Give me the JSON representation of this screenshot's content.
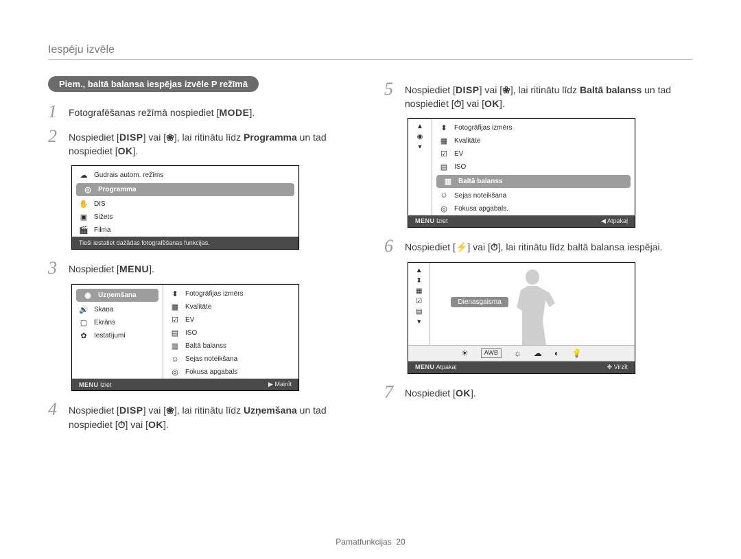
{
  "header": "Iespēju izvēle",
  "example_pill": "Piem., baltā balansa iespējas izvēle P režīmā",
  "keys": {
    "mode": "MODE",
    "disp": "DISP",
    "menu": "MENU",
    "ok": "OK"
  },
  "sym": {
    "flower": "❀",
    "timer": "⏱",
    "flash": "⚡",
    "left": "◀",
    "right": "▶",
    "scroll": "↕"
  },
  "steps": {
    "s1": "Fotografēšanas režīmā nospiediet [",
    "s1_end": "].",
    "s2_a": "Nospiediet [",
    "s2_b": "] vai [",
    "s2_c": "], lai ritinātu līdz ",
    "s2_programma": "Programma",
    "s2_d": " un tad nospiediet [",
    "s2_e": "].",
    "s3": "Nospiediet [",
    "s3_end": "].",
    "s4_a": "Nospiediet [",
    "s4_b": "] vai [",
    "s4_c": "], lai ritinātu līdz ",
    "s4_uznem": "Uzņemšana",
    "s4_d": " un tad nospiediet [",
    "s4_e": "] vai [",
    "s4_f": "].",
    "s5_a": "Nospiediet [",
    "s5_b": "] vai [",
    "s5_c": "], lai ritinātu līdz ",
    "s5_bb": "Baltā balanss",
    "s5_d": " un tad nospiediet [",
    "s5_e": "] vai [",
    "s5_f": "].",
    "s6_a": "Nospiediet [",
    "s6_b": "] vai [",
    "s6_c": "], lai ritinātu līdz baltā balansa iespējai.",
    "s7": "Nospiediet [",
    "s7_end": "]."
  },
  "panel1": {
    "items": [
      "Gudrais autom. režīms",
      "Programma",
      "DIS",
      "Sižets",
      "Filma"
    ],
    "hint": "Tieši iestatiet dažādas fotografēšanas funkcijas."
  },
  "panel2": {
    "left": [
      "Uzņemšana",
      "Skaņa",
      "Ekrāns",
      "Iestatījumi"
    ],
    "right": [
      "Fotogrāfijas izmērs",
      "Kvalitāte",
      "EV",
      "ISO",
      "Baltā balanss",
      "Sejas noteikšana",
      "Fokusa apgabals"
    ],
    "footer_left": "Iziet",
    "footer_right": "Mainīt"
  },
  "panel3": {
    "items": [
      "Fotogrāfijas izmērs",
      "Kvalitāte",
      "EV",
      "ISO",
      "Baltā balanss",
      "Sejas noteikšana",
      "Fokusa apgabals."
    ],
    "footer_left": "Iziet",
    "footer_right": "Atpakaļ"
  },
  "panel4": {
    "label": "Dienasgaisma",
    "footer_left": "Atpakaļ",
    "footer_right": "Virzīt"
  },
  "footer": {
    "section": "Pamatfunkcijas",
    "page": "20"
  }
}
